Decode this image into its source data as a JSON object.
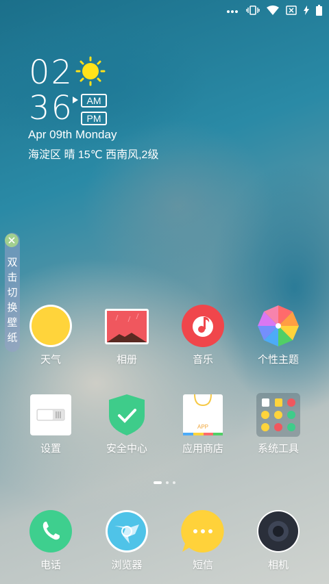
{
  "clock": {
    "hour": "02",
    "minute": "36",
    "am": "AM",
    "pm": "PM",
    "selected_period": "AM"
  },
  "date": "Apr 09th Monday",
  "weather": "海淀区 晴 15℃ 西南风,2级",
  "weather_icon": "sun-icon",
  "wallpaper_tab": {
    "text": [
      "双",
      "击",
      "切",
      "换",
      "壁",
      "纸"
    ]
  },
  "apps_row1": [
    {
      "label": "天气",
      "icon": "weather-icon"
    },
    {
      "label": "相册",
      "icon": "gallery-icon"
    },
    {
      "label": "音乐",
      "icon": "music-icon"
    },
    {
      "label": "个性主题",
      "icon": "theme-icon"
    }
  ],
  "apps_row2": [
    {
      "label": "设置",
      "icon": "settings-icon"
    },
    {
      "label": "安全中心",
      "icon": "security-icon"
    },
    {
      "label": "应用商店",
      "icon": "app-store-icon",
      "badge": "APP"
    },
    {
      "label": "系统工具",
      "icon": "system-tools-folder-icon"
    }
  ],
  "dock": [
    {
      "label": "电话",
      "icon": "phone-icon"
    },
    {
      "label": "浏览器",
      "icon": "browser-icon"
    },
    {
      "label": "短信",
      "icon": "messages-icon"
    },
    {
      "label": "相机",
      "icon": "camera-icon"
    }
  ],
  "pager": {
    "pages": 3,
    "current": 1
  },
  "colors": {
    "phone": "#3ecf8e",
    "music": "#f0464b",
    "messages": "#ffd23a",
    "security": "#3ecc8a",
    "weather": "#ffd43b"
  }
}
